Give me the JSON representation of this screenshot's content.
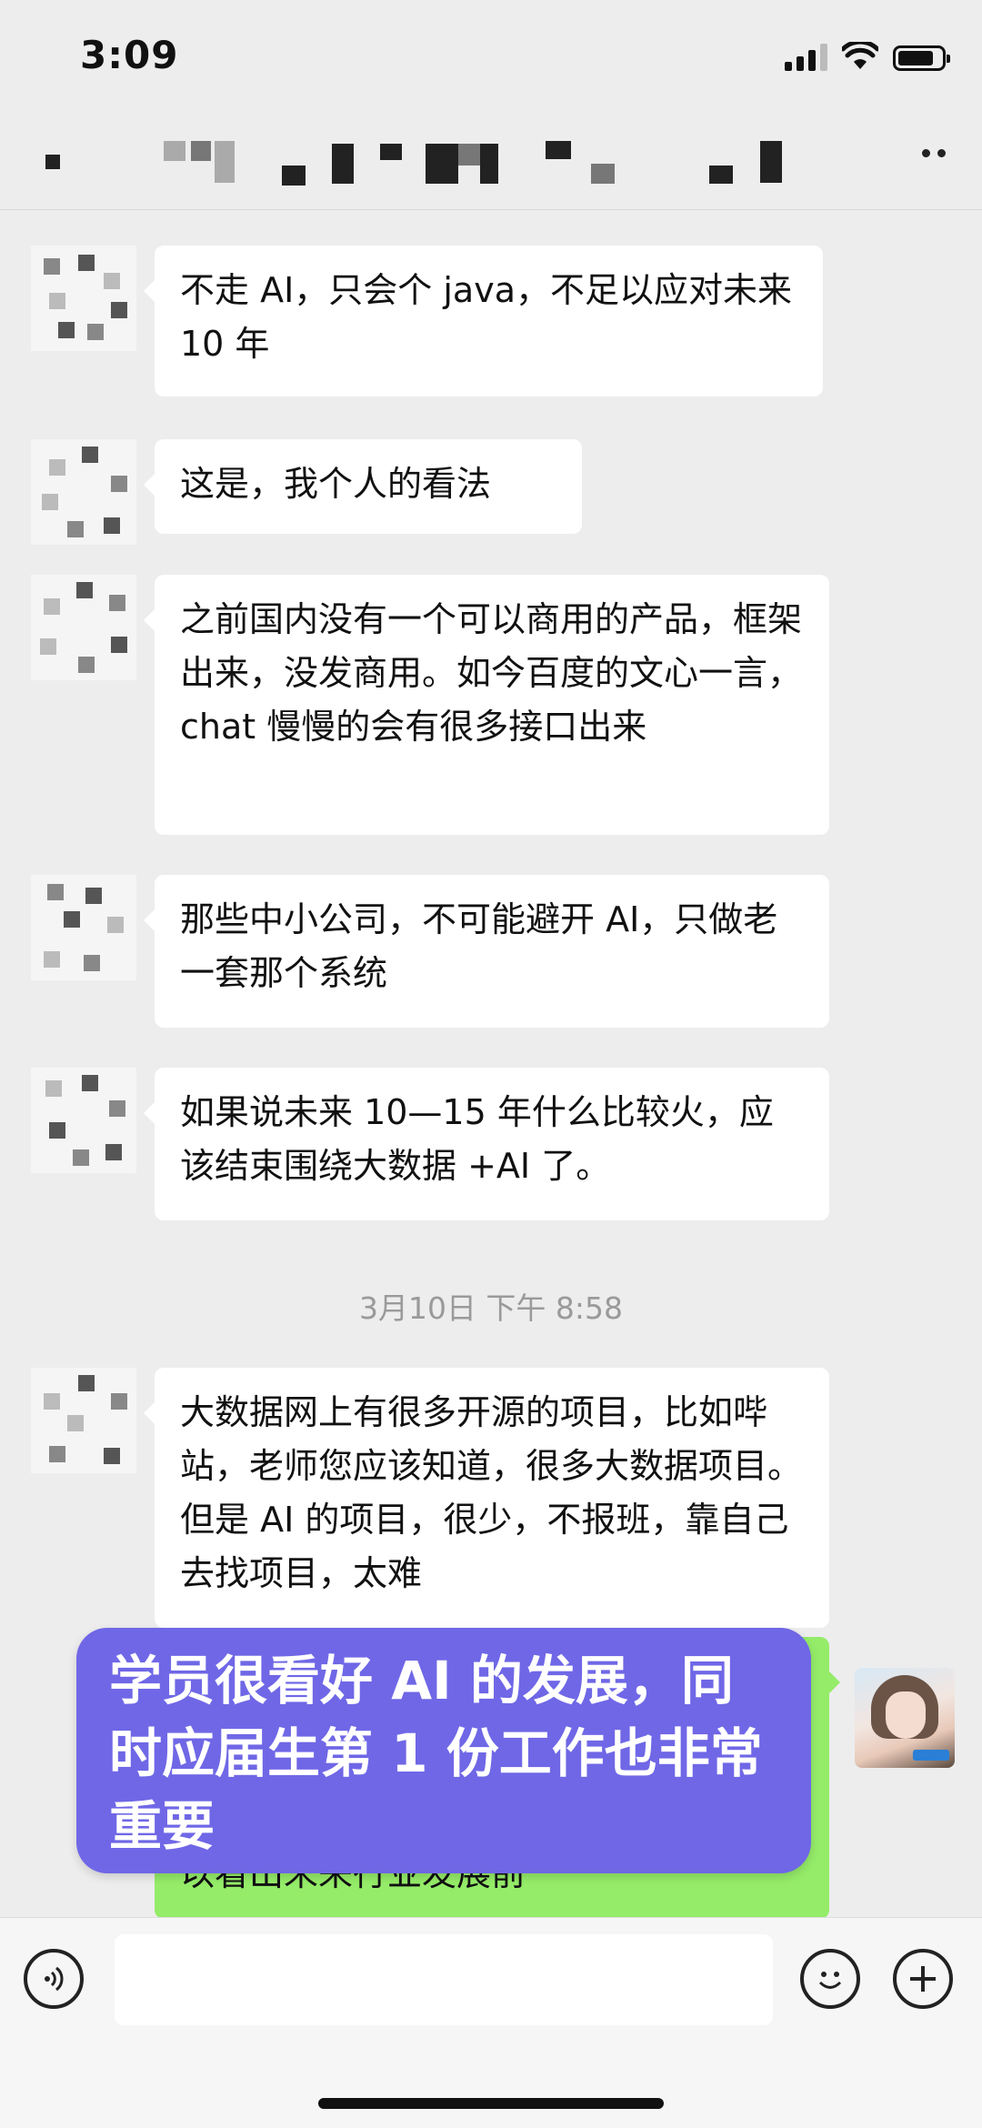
{
  "status_bar": {
    "time": "3:09",
    "signal_icon": "signal-bars-icon",
    "wifi_icon": "wifi-icon",
    "battery_icon": "battery-icon"
  },
  "navbar": {
    "title_icon": "pixelated-title",
    "more_icon": "more-dots-icon"
  },
  "messages": [
    {
      "text": "不走 AI，只会个 java，不足以应对未来 10 年"
    },
    {
      "text": "这是，我个人的看法"
    },
    {
      "text": "之前国内没有一个可以商用的产品，框架出来，没发商用。如今百度的文心一言，chat 慢慢的会有很多接口出来"
    },
    {
      "text": "那些中小公司，不可能避开 AI，只做老一套那个系统"
    },
    {
      "text": "如果说未来 10—15 年什么比较火，应该结束围绕大数据 +AI 了。"
    },
    {
      "text": "大数据网上有很多开源的项目，比如哔站，老师您应该知道，很多大数据项目。但是 AI 的项目，很少，不报班，靠自己去找项目，太难"
    },
    {
      "text": "而且目前 Chat GDP 出来之后很明显可以看出未来行业发展前"
    }
  ],
  "timestamp": "3月10日 下午 8:58",
  "overlay_caption": "学员很看好 AI 的发展，同时应届生第 1 份工作也非常重要",
  "input_bar": {
    "voice_icon": "voice-icon",
    "emoji_icon": "emoji-icon",
    "plus_icon": "plus-icon"
  },
  "colors": {
    "background": "#ededed",
    "bubble_white": "#ffffff",
    "bubble_green": "#95ec69",
    "overlay": "#6f67e6"
  }
}
